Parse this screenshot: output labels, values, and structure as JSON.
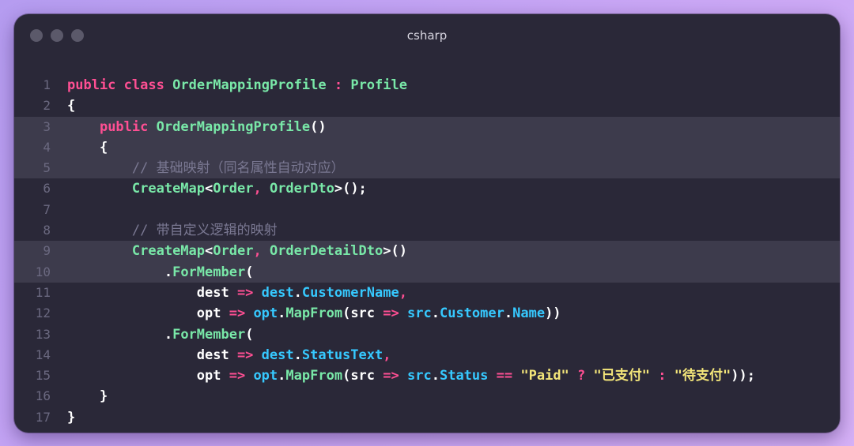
{
  "window": {
    "title": "csharp"
  },
  "code": {
    "highlighted_lines": [
      3,
      4,
      5,
      9,
      10
    ],
    "lines": [
      {
        "n": "1",
        "tokens": [
          [
            "kw",
            "public"
          ],
          [
            "pl",
            " "
          ],
          [
            "kw",
            "class"
          ],
          [
            "pl",
            " "
          ],
          [
            "cls",
            "OrderMappingProfile"
          ],
          [
            "pl",
            " "
          ],
          [
            "op",
            ":"
          ],
          [
            "pl",
            " "
          ],
          [
            "cls",
            "Profile"
          ]
        ]
      },
      {
        "n": "2",
        "tokens": [
          [
            "pn",
            "{"
          ]
        ]
      },
      {
        "n": "3",
        "tokens": [
          [
            "pl",
            "    "
          ],
          [
            "kw",
            "public"
          ],
          [
            "pl",
            " "
          ],
          [
            "fn",
            "OrderMappingProfile"
          ],
          [
            "pn",
            "()"
          ]
        ]
      },
      {
        "n": "4",
        "tokens": [
          [
            "pl",
            "    "
          ],
          [
            "pn",
            "{"
          ]
        ]
      },
      {
        "n": "5",
        "tokens": [
          [
            "pl",
            "        "
          ],
          [
            "cmt",
            "// 基础映射（同名属性自动对应）"
          ]
        ]
      },
      {
        "n": "6",
        "tokens": [
          [
            "pl",
            "        "
          ],
          [
            "fn",
            "CreateMap"
          ],
          [
            "pn",
            "<"
          ],
          [
            "cls",
            "Order"
          ],
          [
            "op",
            ","
          ],
          [
            "pl",
            " "
          ],
          [
            "cls",
            "OrderDto"
          ],
          [
            "pn",
            ">();"
          ]
        ]
      },
      {
        "n": "7",
        "tokens": []
      },
      {
        "n": "8",
        "tokens": [
          [
            "pl",
            "        "
          ],
          [
            "cmt",
            "// 带自定义逻辑的映射"
          ]
        ]
      },
      {
        "n": "9",
        "tokens": [
          [
            "pl",
            "        "
          ],
          [
            "fn",
            "CreateMap"
          ],
          [
            "pn",
            "<"
          ],
          [
            "cls",
            "Order"
          ],
          [
            "op",
            ","
          ],
          [
            "pl",
            " "
          ],
          [
            "cls",
            "OrderDetailDto"
          ],
          [
            "pn",
            ">()"
          ]
        ]
      },
      {
        "n": "10",
        "tokens": [
          [
            "pl",
            "            "
          ],
          [
            "pn",
            "."
          ],
          [
            "fn",
            "ForMember"
          ],
          [
            "pn",
            "("
          ]
        ]
      },
      {
        "n": "11",
        "tokens": [
          [
            "pl",
            "                dest "
          ],
          [
            "op",
            "=>"
          ],
          [
            "pl",
            " "
          ],
          [
            "prop",
            "dest"
          ],
          [
            "pn",
            "."
          ],
          [
            "prop",
            "CustomerName"
          ],
          [
            "op",
            ","
          ]
        ]
      },
      {
        "n": "12",
        "tokens": [
          [
            "pl",
            "                opt "
          ],
          [
            "op",
            "=>"
          ],
          [
            "pl",
            " "
          ],
          [
            "prop",
            "opt"
          ],
          [
            "pn",
            "."
          ],
          [
            "fn",
            "MapFrom"
          ],
          [
            "pn",
            "("
          ],
          [
            "pl",
            "src "
          ],
          [
            "op",
            "=>"
          ],
          [
            "pl",
            " "
          ],
          [
            "prop",
            "src"
          ],
          [
            "pn",
            "."
          ],
          [
            "prop",
            "Customer"
          ],
          [
            "pn",
            "."
          ],
          [
            "prop",
            "Name"
          ],
          [
            "pn",
            "))"
          ]
        ]
      },
      {
        "n": "13",
        "tokens": [
          [
            "pl",
            "            "
          ],
          [
            "pn",
            "."
          ],
          [
            "fn",
            "ForMember"
          ],
          [
            "pn",
            "("
          ]
        ]
      },
      {
        "n": "14",
        "tokens": [
          [
            "pl",
            "                dest "
          ],
          [
            "op",
            "=>"
          ],
          [
            "pl",
            " "
          ],
          [
            "prop",
            "dest"
          ],
          [
            "pn",
            "."
          ],
          [
            "prop",
            "StatusText"
          ],
          [
            "op",
            ","
          ]
        ]
      },
      {
        "n": "15",
        "tokens": [
          [
            "pl",
            "                opt "
          ],
          [
            "op",
            "=>"
          ],
          [
            "pl",
            " "
          ],
          [
            "prop",
            "opt"
          ],
          [
            "pn",
            "."
          ],
          [
            "fn",
            "MapFrom"
          ],
          [
            "pn",
            "("
          ],
          [
            "pl",
            "src "
          ],
          [
            "op",
            "=>"
          ],
          [
            "pl",
            " "
          ],
          [
            "prop",
            "src"
          ],
          [
            "pn",
            "."
          ],
          [
            "prop",
            "Status"
          ],
          [
            "pl",
            " "
          ],
          [
            "op",
            "=="
          ],
          [
            "pl",
            " "
          ],
          [
            "str",
            "\"Paid\""
          ],
          [
            "pl",
            " "
          ],
          [
            "op",
            "?"
          ],
          [
            "pl",
            " "
          ],
          [
            "str",
            "\"已支付\""
          ],
          [
            "pl",
            " "
          ],
          [
            "op",
            ":"
          ],
          [
            "pl",
            " "
          ],
          [
            "str",
            "\"待支付\""
          ],
          [
            "pn",
            "));"
          ]
        ]
      },
      {
        "n": "16",
        "tokens": [
          [
            "pl",
            "    "
          ],
          [
            "pn",
            "}"
          ]
        ]
      },
      {
        "n": "17",
        "tokens": [
          [
            "pn",
            "}"
          ]
        ]
      }
    ]
  }
}
